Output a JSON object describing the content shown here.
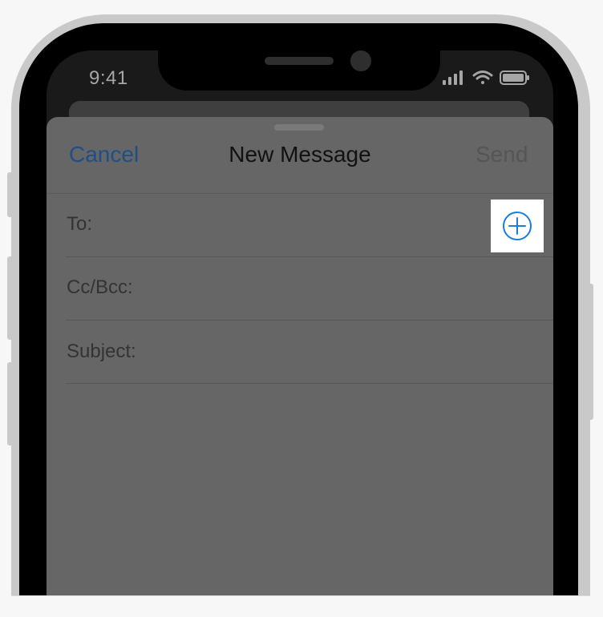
{
  "status_bar": {
    "time": "9:41",
    "icons": [
      "signal-icon",
      "wifi-icon",
      "battery-icon"
    ]
  },
  "compose": {
    "nav": {
      "cancel_label": "Cancel",
      "title": "New Message",
      "send_label": "Send"
    },
    "fields": {
      "to_label": "To:",
      "cc_bcc_label": "Cc/Bcc:",
      "subject_label": "Subject:"
    },
    "add_contact_icon": "add-circle-icon"
  },
  "colors": {
    "accent_blue": "#1a7de0",
    "cancel_dimmed": "#1f4f86",
    "sheet_dimmed": "#666666",
    "highlight": "#ffffff"
  }
}
